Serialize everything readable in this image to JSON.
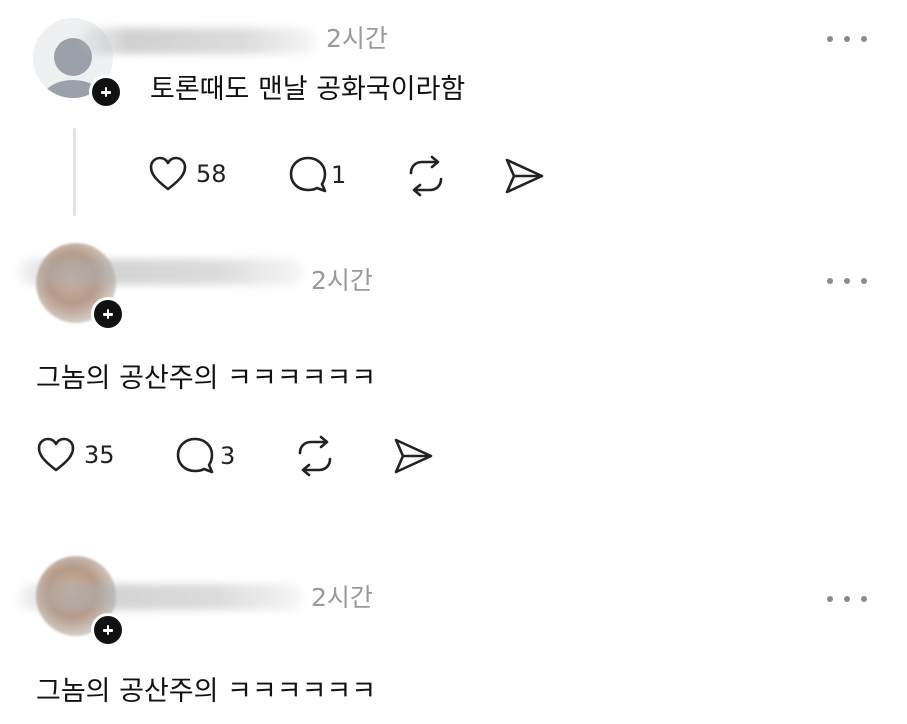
{
  "posts": [
    {
      "avatar": "default-avatar",
      "time": "2시간",
      "text": "토론때도 맨날 공화국이라함",
      "likes": "58",
      "replies": "1"
    },
    {
      "avatar": "photo-avatar",
      "time": "2시간",
      "text": "그놈의 공산주의 ㅋㅋㅋㅋㅋㅋ",
      "likes": "35",
      "replies": "3"
    },
    {
      "avatar": "photo-avatar",
      "time": "2시간",
      "text": "그놈의 공산주의 ㅋㅋㅋㅋㅋㅋ"
    }
  ],
  "icons": {
    "like": "heart-icon",
    "reply": "comment-icon",
    "repost": "repost-icon",
    "share": "send-icon",
    "more": "more-icon",
    "follow": "plus-icon"
  },
  "colors": {
    "text": "#111111",
    "muted": "#9a9a9a",
    "icon": "#222222"
  }
}
